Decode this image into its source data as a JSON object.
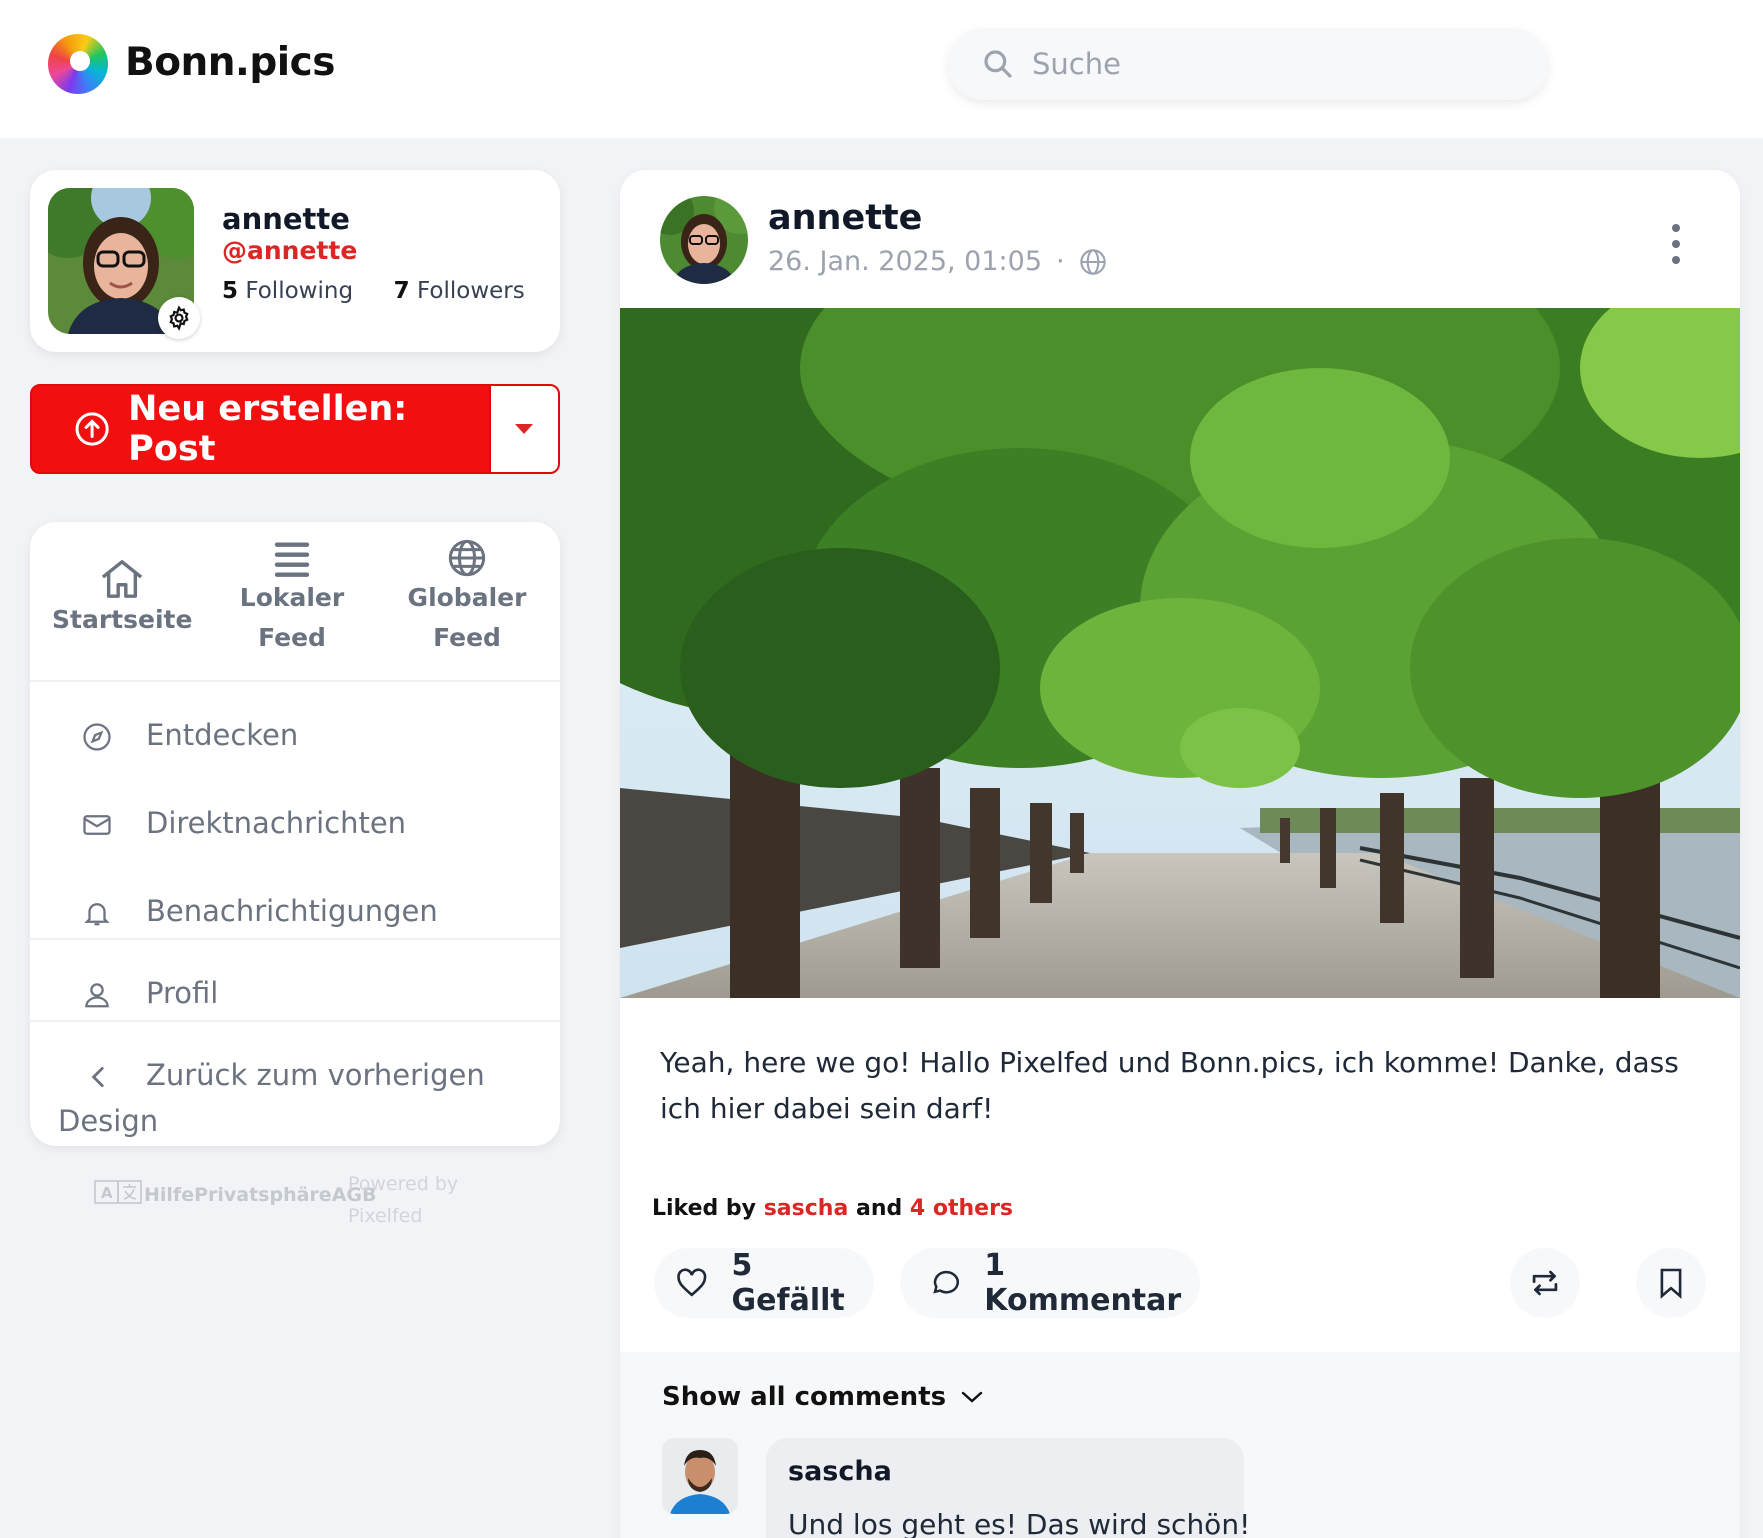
{
  "header": {
    "brand": "Bonn.pics",
    "search_placeholder": "Suche"
  },
  "profile": {
    "name": "annette",
    "handle": "@annette",
    "following_count": "5",
    "following_label": "Following",
    "followers_count": "7",
    "followers_label": "Followers"
  },
  "create": {
    "label": "Neu erstellen: Post"
  },
  "nav": {
    "tabs": [
      {
        "line1": "Startseite",
        "line2": ""
      },
      {
        "line1": "Lokaler",
        "line2": "Feed"
      },
      {
        "line1": "Globaler",
        "line2": "Feed"
      }
    ],
    "items": [
      {
        "label": "Entdecken"
      },
      {
        "label": "Direktnachrichten"
      },
      {
        "label": "Benachrichtigungen"
      },
      {
        "label": "Profil"
      }
    ],
    "back_line1": "Zurück zum vorherigen",
    "back_line2": "Design"
  },
  "footer": {
    "links": "HilfePrivatsphäreAGB",
    "powered_line1": "Powered by",
    "powered_line2": "Pixelfed"
  },
  "post": {
    "user": "annette",
    "date": "26. Jan. 2025, 01:05",
    "separator": "·",
    "caption": "Yeah, here we go! Hallo Pixelfed und Bonn.pics, ich komme! Danke, dass ich hier dabei sein darf!",
    "liked_prefix": "Liked by",
    "liked_user": "sascha",
    "liked_and": "and",
    "liked_others": "4 others",
    "likes_label": "5 Gefällt",
    "comments_label": "1 Kommentar",
    "show_all_comments": "Show all comments",
    "comment": {
      "user": "sascha",
      "text": "Und los geht es! Das wird schön!"
    }
  },
  "colors": {
    "accent_red": "#f20f0f",
    "handle_red": "#dc2626",
    "background": "#f2f3f6"
  },
  "icons": [
    "search-icon",
    "gear-icon",
    "upload-icon",
    "caret-down-icon",
    "home-icon",
    "list-icon",
    "globe-icon",
    "compass-icon",
    "mail-icon",
    "bell-icon",
    "user-icon",
    "chevron-left-icon",
    "translate-icon",
    "more-vertical-icon",
    "heart-icon",
    "comment-icon",
    "repost-icon",
    "bookmark-icon",
    "chevron-down-icon"
  ]
}
